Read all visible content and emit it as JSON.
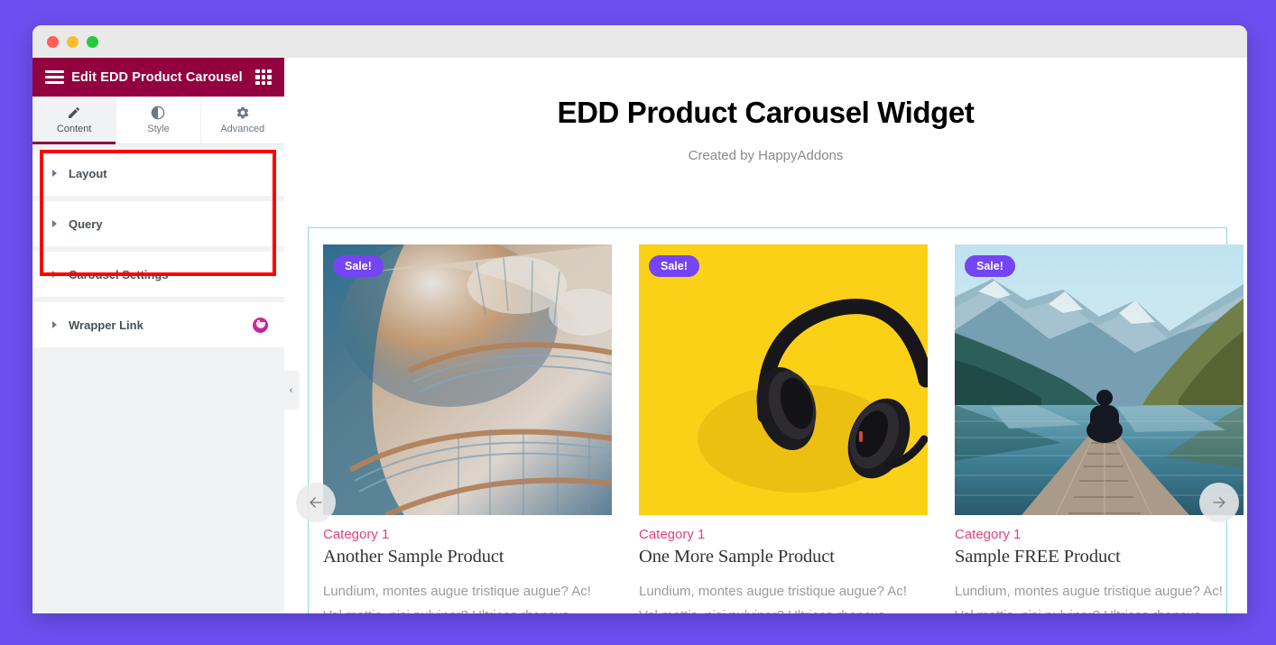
{
  "window": {
    "traffic_lights": [
      "close",
      "minimize",
      "maximize"
    ]
  },
  "panel": {
    "header": {
      "menu_icon": "hamburger-icon",
      "title": "Edit EDD Product Carousel",
      "apps_icon": "grid-apps-icon"
    },
    "tabs": [
      {
        "label": "Content",
        "icon": "pencil-icon",
        "active": true
      },
      {
        "label": "Style",
        "icon": "contrast-circle-icon",
        "active": false
      },
      {
        "label": "Advanced",
        "icon": "gear-icon",
        "active": false
      }
    ],
    "sections": [
      {
        "label": "Layout",
        "pro": false,
        "highlighted": true
      },
      {
        "label": "Query",
        "pro": false,
        "highlighted": true
      },
      {
        "label": "Carousel Settings",
        "pro": false,
        "highlighted": true
      },
      {
        "label": "Wrapper Link",
        "pro": true,
        "highlighted": false
      }
    ],
    "collapse_handle": "‹",
    "highlight_color": "#ff0000",
    "header_color": "#93003f"
  },
  "canvas": {
    "title": "EDD Product Carousel Widget",
    "subtitle": "Created by HappyAddons",
    "carousel": {
      "prev_label": "Previous slide",
      "next_label": "Next slide",
      "border_color": "#8ed5f0",
      "badge_color": "#7544f4",
      "category_color": "#e0447c",
      "slides": [
        {
          "badge": "Sale!",
          "category": "Category 1",
          "title": "Another Sample Product",
          "excerpt": "Lundium, montes augue tristique augue? Ac! Vel mattis, nisi pulvinar? Ultrices rhoncus integer, scelerisque phasellus…",
          "image": "spiral-staircase-photo"
        },
        {
          "badge": "Sale!",
          "category": "Category 1",
          "title": "One More Sample Product",
          "excerpt": "Lundium, montes augue tristique augue? Ac! Vel mattis, nisi pulvinar? Ultrices rhoncus integer, scelerisque phasellus…",
          "image": "black-headphones-on-yellow-photo"
        },
        {
          "badge": "Sale!",
          "category": "Category 1",
          "title": "Sample FREE Product",
          "excerpt": "Lundium, montes augue tristique augue? Ac! Vel mattis, nisi pulvinar? Ultrices rhoncus integer, scelerisque phasellus…",
          "image": "person-on-dock-mountain-lake-photo"
        }
      ]
    }
  }
}
